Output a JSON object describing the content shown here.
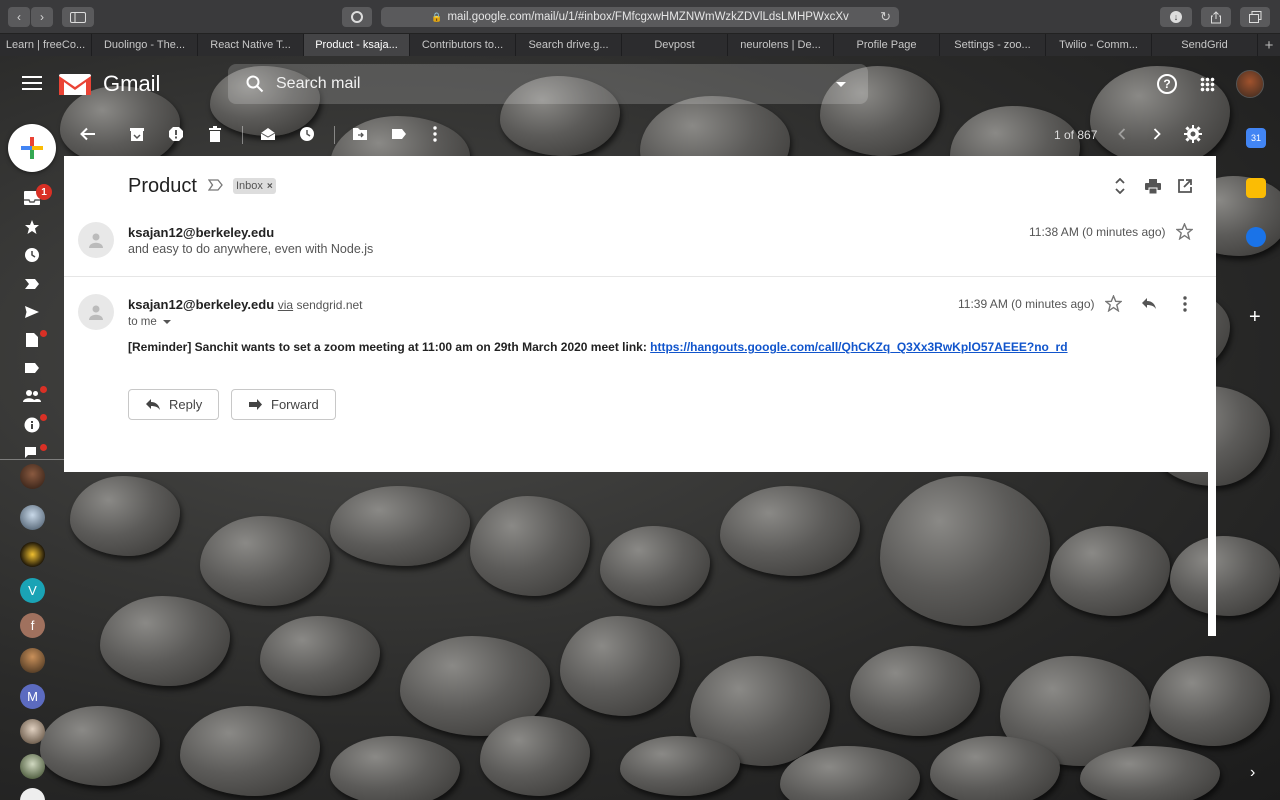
{
  "browser": {
    "url": "mail.google.com/mail/u/1/#inbox/FMfcgxwHMZNWmWzkZDVlLdsLMHPWxcXv",
    "tabs": [
      {
        "label": "Learn | freeCo...",
        "active": false
      },
      {
        "label": "Duolingo - The...",
        "active": false
      },
      {
        "label": "React Native T...",
        "active": false
      },
      {
        "label": "Product - ksaja...",
        "active": true
      },
      {
        "label": "Contributors to...",
        "active": false
      },
      {
        "label": "Search drive.g...",
        "active": false
      },
      {
        "label": "Devpost",
        "active": false
      },
      {
        "label": "neurolens | De...",
        "active": false
      },
      {
        "label": "Profile Page",
        "active": false
      },
      {
        "label": "Settings - zoo...",
        "active": false
      },
      {
        "label": "Twilio - Comm...",
        "active": false
      },
      {
        "label": "SendGrid",
        "active": false
      }
    ],
    "new_tab": "+"
  },
  "gmail": {
    "app_name": "Gmail",
    "search_placeholder": "Search mail",
    "help": "?",
    "pagination": "1 of 867",
    "inbox_badge": "1"
  },
  "thread": {
    "subject": "Product",
    "label": "Inbox",
    "label_remove": "×",
    "messages": [
      {
        "from": "ksajan12@berkeley.edu",
        "snippet": "and easy to do anywhere, even with Node.js",
        "time": "11:38 AM (0 minutes ago)"
      },
      {
        "from": "ksajan12@berkeley.edu",
        "via_word": "via",
        "via_domain": "sendgrid.net",
        "to": "to me",
        "time": "11:39 AM (0 minutes ago)",
        "body": "[Reminder] Sanchit wants to set a zoom meeting at 11:00 am on 29th March 2020 meet link: ",
        "link": "https://hangouts.google.com/call/QhCKZq_Q3Xx3RwKplO57AEEE?no_rd"
      }
    ],
    "reply_label": "Reply",
    "forward_label": "Forward"
  },
  "hangouts": [
    {
      "initial": "V",
      "color": "#1aa3b5"
    },
    {
      "initial": "f",
      "color": "#a0715e"
    },
    {
      "initial": "M",
      "color": "#5c6bc0"
    }
  ],
  "colors": {
    "gmail_red": "#ea4335",
    "link_blue": "#1155cc",
    "badge_red": "#d93025"
  }
}
